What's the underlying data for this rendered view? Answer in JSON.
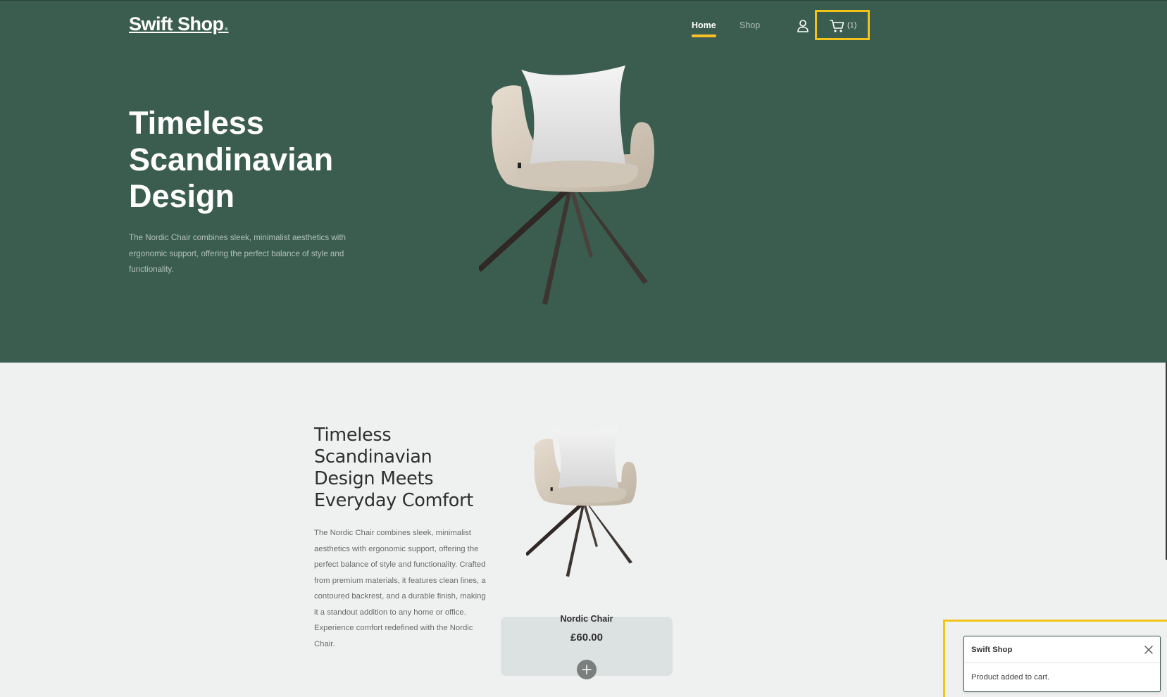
{
  "header": {
    "logo": "Swift Shop",
    "logo_dot": ".",
    "nav": {
      "home": "Home",
      "shop": "Shop"
    },
    "cart_count": "(1)",
    "active_nav": "Home"
  },
  "hero": {
    "title": "Timeless Scandinavian Design",
    "description": "The Nordic Chair combines sleek, minimalist aesthetics with ergonomic support, offering the perfect balance of style and functionality.",
    "image": "chair-image"
  },
  "product_section": {
    "title": "Timeless Scandinavian Design Meets Everyday Comfort",
    "description": "The Nordic Chair combines sleek, minimalist aesthetics with ergonomic support, offering the perfect balance of style and functionality. Crafted from premium materials, it features clean lines, a contoured backrest, and a durable finish, making it a standout addition to any home or office. Experience comfort redefined with the Nordic Chair.",
    "product": {
      "name": "Nordic Chair",
      "price": "£60.00",
      "add_icon": "plus-icon"
    }
  },
  "toast": {
    "title": "Swift Shop",
    "message": "Product added to cart.",
    "close_icon": "close-icon"
  },
  "colors": {
    "hero_bg": "#3b5d50",
    "accent": "#f9bf29",
    "page_bg": "#eff1f0",
    "card_bg": "#dce2e1",
    "highlight": "#f0c419"
  }
}
